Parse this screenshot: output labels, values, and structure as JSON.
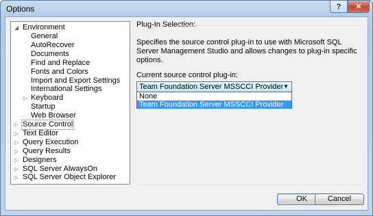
{
  "window": {
    "title": "Options",
    "help_glyph": "?",
    "close_glyph": "✕"
  },
  "tree": {
    "environment": {
      "label": "Environment",
      "expander": "◢"
    },
    "env_children": [
      "General",
      "AutoRecover",
      "Documents",
      "Find and Replace",
      "Fonts and Colors",
      "Import and Export Settings",
      "International Settings",
      "Keyboard",
      "Startup",
      "Web Browser"
    ],
    "keyboard_expander": "▷",
    "top_items": [
      {
        "label": "Source Control",
        "selected": true
      },
      {
        "label": "Text Editor"
      },
      {
        "label": "Query Execution"
      },
      {
        "label": "Query Results"
      },
      {
        "label": "Designers"
      },
      {
        "label": "SQL Server AlwaysOn"
      },
      {
        "label": "SQL Server Object Explorer"
      }
    ],
    "collapsed_glyph": "▷"
  },
  "panel": {
    "section_title": "Plug-In Selection:",
    "description": "Specifies the source control plug-in to use with Microsoft SQL Server Management Studio and allows changes to plug-in specific options.",
    "combo_label": "Current source control plug-in:",
    "combo_value": "Team Foundation Server MSSCCI Provider",
    "combo_arrow": "▼",
    "options": [
      {
        "label": "None",
        "selected": false
      },
      {
        "label": "Team Foundation Server MSSCCI Provider",
        "selected": true
      }
    ]
  },
  "buttons": {
    "ok": "OK",
    "cancel": "Cancel"
  }
}
